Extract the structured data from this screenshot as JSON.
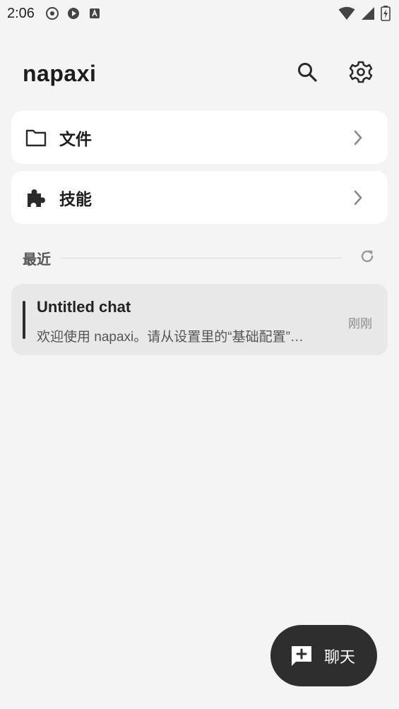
{
  "status_bar": {
    "time": "2:06",
    "left_icons": [
      "music-disc-icon",
      "play-circle-icon",
      "a-letter-icon"
    ],
    "right_icons": [
      "wifi-icon",
      "signal-icon",
      "battery-charging-icon"
    ]
  },
  "header": {
    "title": "napaxi",
    "actions": [
      "search-icon",
      "gear-icon"
    ]
  },
  "cards": [
    {
      "label": "文件",
      "icon": "folder-icon"
    },
    {
      "label": "技能",
      "icon": "puzzle-icon"
    }
  ],
  "recent": {
    "label": "最近",
    "refresh_icon": "refresh-icon"
  },
  "chats": [
    {
      "title": "Untitled chat",
      "preview": "欢迎使用 napaxi。请从设置里的“基础配置”…",
      "time": "刚刚"
    }
  ],
  "fab": {
    "label": "聊天",
    "icon": "add-comment-icon"
  },
  "colors": {
    "background": "#f4f4f4",
    "card": "#ffffff",
    "chat_item": "#e8e8e8",
    "fab": "#2e2e2e"
  }
}
